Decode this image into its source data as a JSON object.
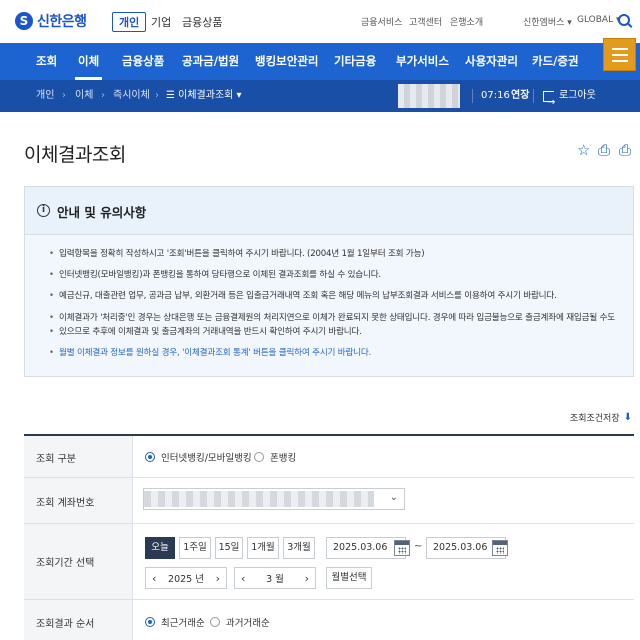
{
  "header": {
    "logo_text": "신한은행",
    "segments": [
      "개인",
      "기업",
      "금융상품"
    ],
    "utility_links": [
      "금융서비스",
      "고객센터",
      "은행소개"
    ],
    "family_menu": "신한엠버스",
    "global_menu": "GLOBAL"
  },
  "nav": {
    "items": [
      "조회",
      "이체",
      "금융상품",
      "공과금/법원",
      "뱅킹보안관리",
      "기타금융",
      "부가서비스",
      "사용자관리",
      "카드/증권"
    ],
    "active_index": 1
  },
  "breadcrumb": {
    "items": [
      "개인",
      "이체",
      "즉시이체",
      "이체결과조회"
    ],
    "timer": "07:16",
    "extend_label": "연장",
    "logout_label": "로그아웃"
  },
  "page": {
    "title": "이체결과조회"
  },
  "notice": {
    "title": "안내 및 유의사항",
    "items": [
      "입력항목을 정확히 작성하시고 '조회'버튼을 클릭하여 주시기 바랍니다. (2004년 1월 1일부터 조회 가능)",
      "인터넷뱅킹(모바일뱅킹)과 폰뱅킹을 통하여 당타행으로 이체된 결과조회를 하실 수 있습니다.",
      "예금신규, 대출관련 업무, 공과금 납부, 외환거래 등은 입출금거래내역 조회 혹은 해당 메뉴의 납부조회결과 서비스를 이용하여 주시기 바랍니다.",
      "이체결과가 '처리중'인 경우는 상대은행 또는 금융결제원의 처리지연으로 이체가 완료되지 못한 상태입니다. 경우에 따라 입금불능으로 출금계좌에 재입금될 수도",
      "있으므로 추후에 이체결과 및 출금계좌의 거래내역을 반드시 확인하여 주시기 바랍니다.",
      "월별 이체결과 정보를 원하실 경우, '이체결과조회 통계' 버튼을 클릭하여 주시기 바랍니다."
    ]
  },
  "form": {
    "save_conditions_label": "조회조건저장",
    "rows": {
      "type": {
        "label": "조회 구분",
        "options": [
          "인터넷뱅킹/모바일뱅킹",
          "폰뱅킹"
        ],
        "selected": 0
      },
      "account": {
        "label": "조회 계좌번호"
      },
      "period": {
        "label": "조회기간 선택",
        "quick_buttons": [
          "오늘",
          "1주일",
          "15일",
          "1개월",
          "3개월"
        ],
        "active_quick": 0,
        "start_date": "2025.03.06",
        "end_date": "2025.03.06",
        "separator": "~",
        "year_value": "2025 년",
        "month_value": "3 월",
        "month_select_label": "월별선택"
      },
      "order": {
        "label": "조회결과 순서",
        "options": [
          "최근거래순",
          "과거거래순"
        ],
        "selected": 0
      }
    }
  }
}
